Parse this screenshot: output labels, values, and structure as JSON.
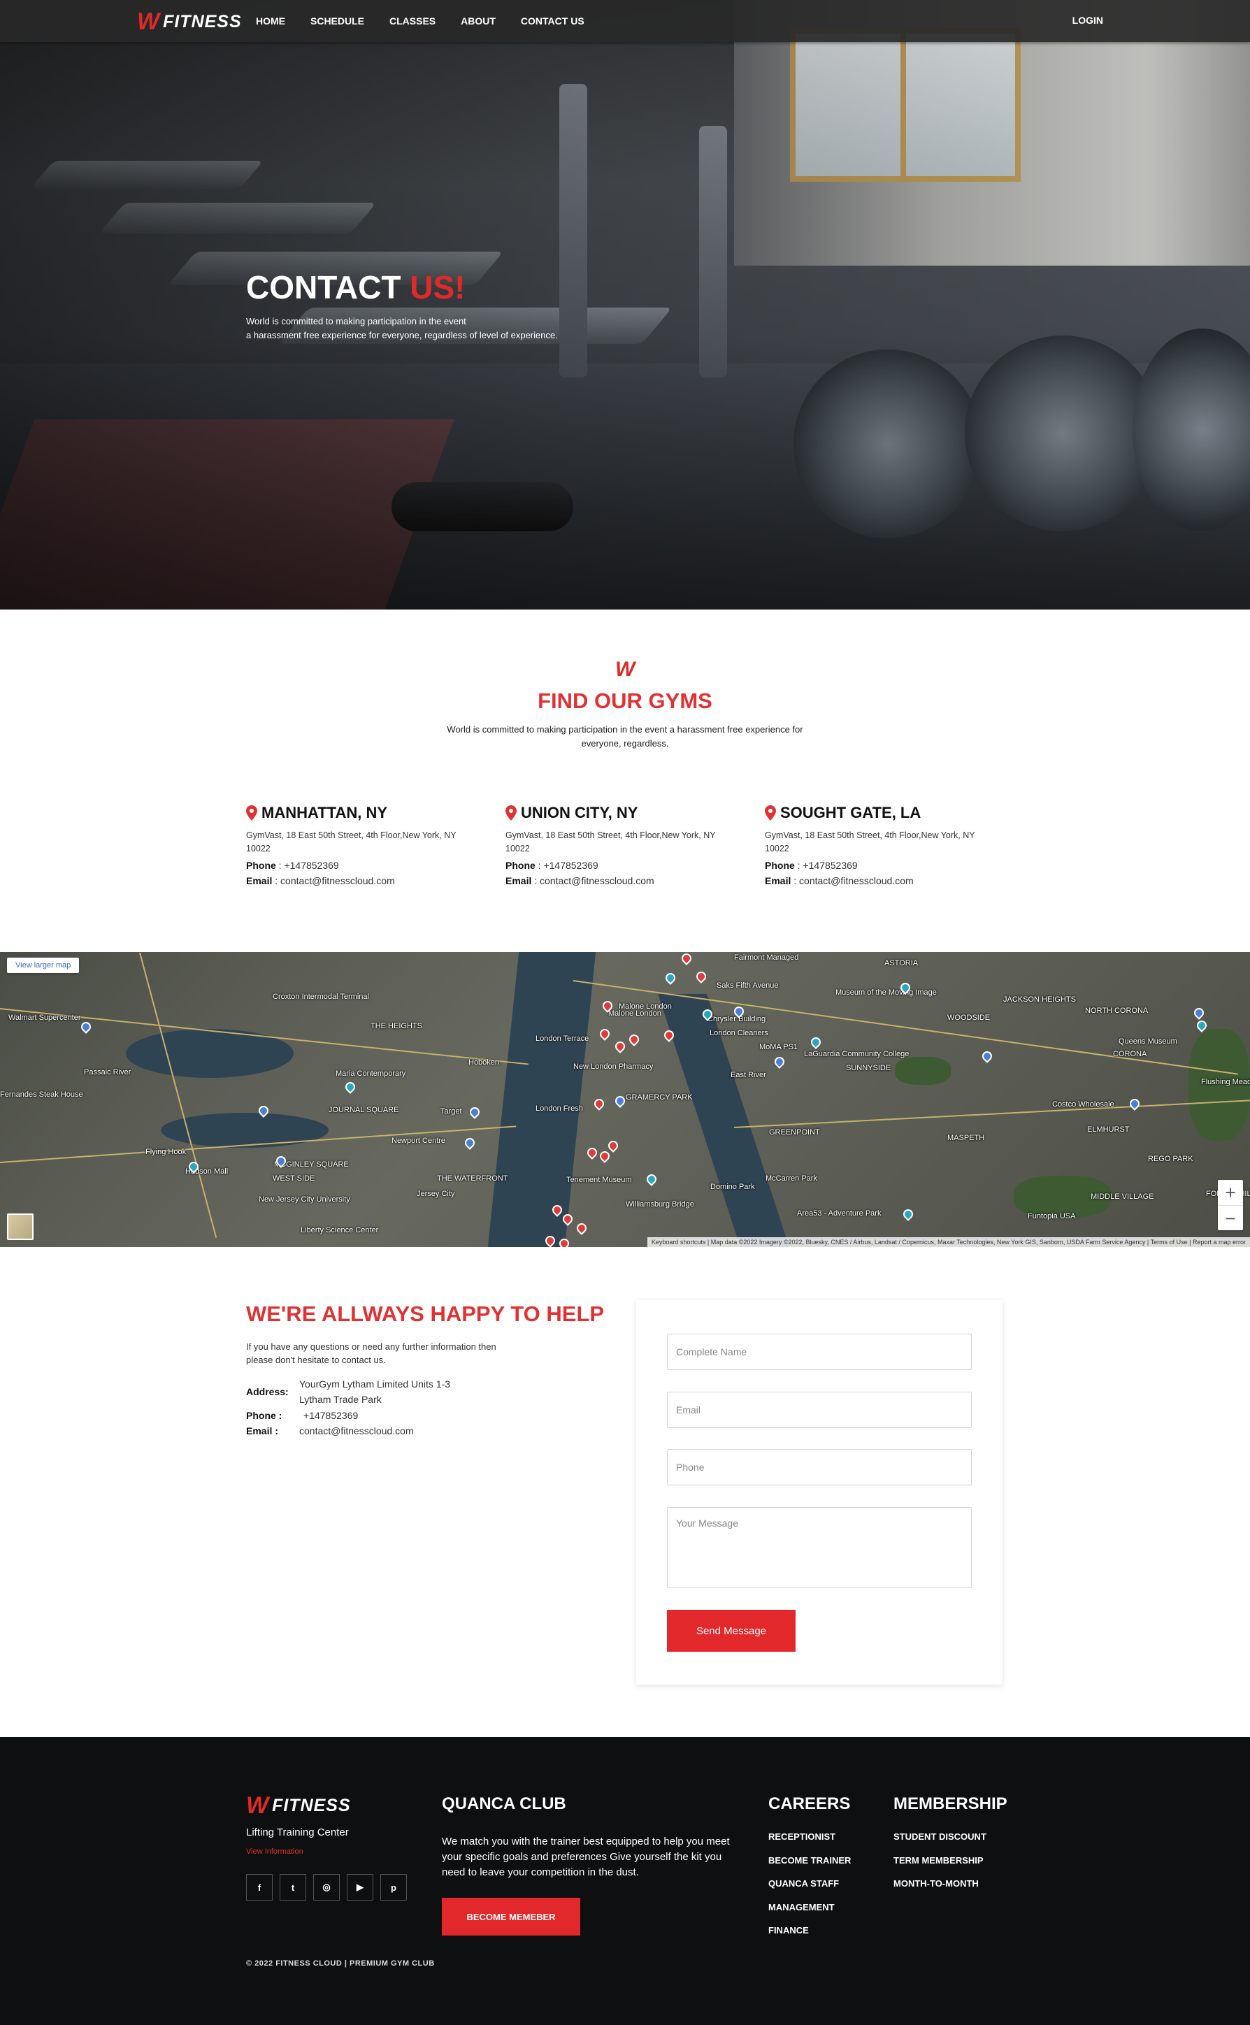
{
  "brand": {
    "name": "FITNESS",
    "accent": "#e03232"
  },
  "nav": {
    "links": [
      "HOME",
      "SCHEDULE",
      "CLASSES",
      "ABOUT",
      "CONTACT US"
    ],
    "login": "LOGIN"
  },
  "hero": {
    "title_white": "CONTACT ",
    "title_red": "US!",
    "subtitle_line1": "World is committed to making participation in the event",
    "subtitle_line2": "a harassment free experience for everyone, regardless of level of experience."
  },
  "find": {
    "title": "FIND OUR GYMS",
    "subtitle": "World is committed to making participation in the event a harassment free experience for everyone, regardless."
  },
  "gyms": [
    {
      "name": "MANHATTAN, NY",
      "address": "GymVast, 18 East 50th Street, 4th Floor,New York, NY 10022",
      "phone_label": "Phone",
      "phone": " : +147852369",
      "email_label": "Email",
      "email": " : contact@fitnesscloud.com"
    },
    {
      "name": "UNION CITY, NY",
      "address": "GymVast, 18 East 50th Street, 4th Floor,New York, NY 10022",
      "phone_label": "Phone",
      "phone": " : +147852369",
      "email_label": "Email",
      "email": " : contact@fitnesscloud.com"
    },
    {
      "name": "SOUGHT GATE, LA",
      "address": "GymVast, 18 East 50th Street, 4th Floor,New York, NY 10022",
      "phone_label": "Phone",
      "phone": " : +147852369",
      "email_label": "Email",
      "email": " : contact@fitnesscloud.com"
    }
  ],
  "map": {
    "view_larger": "View larger map",
    "zoom_in": "+",
    "zoom_out": "−",
    "attribution": "Keyboard shortcuts | Map data ©2022 Imagery ©2022, Bluesky, CNES / Airbus, Landsat / Copernicus, Maxar Technologies, New York GIS, Sanborn, USDA Farm Service Agency | Terms of Use | Report a map error",
    "labels": [
      "Walmart Supercenter",
      "THE HEIGHTS",
      "Croxton Intermodal Terminal",
      "Passaic River",
      "Fernandes Steak House",
      "Maria Contemporary",
      "JOURNAL SQUARE",
      "Target",
      "Newport Centre",
      "Hudson Mall",
      "WEST SIDE",
      "MCGINLEY SQUARE",
      "THE WATERFRONT",
      "Jersey City",
      "New Jersey City University",
      "Liberty Science Center",
      "London Terrace",
      "New London Pharmacy",
      "London Fresh",
      "Malone London",
      "Tenement Museum",
      "Williamsburg Bridge",
      "Domino Park",
      "McCarren Park",
      "GRAMERCY PARK",
      "GREENPOINT",
      "Chrysler Building",
      "MoMA PS1",
      "LaGuardia Community College",
      "SUNNYSIDE",
      "ASTORIA",
      "Museum of the Moving Image",
      "WOODSIDE",
      "JACKSON HEIGHTS",
      "NORTH CORONA",
      "Queens Museum",
      "CORONA",
      "ELMHURST",
      "Costco Wholesale",
      "MASPETH",
      "MIDDLE VILLAGE",
      "REGO PARK",
      "FOREST HILLS",
      "Funtopia USA",
      "Area53 - Adventure Park",
      "Flying Hook",
      "Fairmont Managed",
      "Saks Fifth Avenue",
      "Malone London",
      "London Cleaners",
      "Hoboken",
      "East River",
      "Flushing Meadows"
    ]
  },
  "help": {
    "title": "WE'RE ALLWAYS HAPPY TO HELP",
    "subtitle": "If you have any questions or need any further information then please don't hesitate to contact us.",
    "address_label": "Address:",
    "address_line1": "YourGym Lytham Limited Units 1-3",
    "address_line2": "Lytham Trade Park",
    "phone_label": "Phone :",
    "phone": "+147852369",
    "email_label": "Email :",
    "email": "contact@fitnesscloud.com"
  },
  "form": {
    "name_placeholder": "Complete Name",
    "email_placeholder": "Email",
    "phone_placeholder": "Phone",
    "message_placeholder": "Your Message",
    "send": "Send Message"
  },
  "footer": {
    "tagline": "Lifting Training Center",
    "view_info": "View Information",
    "socials": [
      "f",
      "t",
      "◎",
      "▶",
      "p"
    ],
    "club_title": "QUANCA CLUB",
    "club_text": "We match you with the trainer best equipped to help you meet your specific goals and preferences Give yourself the kit you need to leave your competition in the dust.",
    "become": "BECOME MEMEBER",
    "careers_title": "CAREERS",
    "careers": [
      "RECEPTIONIST",
      "BECOME TRAINER",
      "QUANCA STAFF",
      "MANAGEMENT",
      "FINANCE"
    ],
    "membership_title": "MEMBERSHIP",
    "membership": [
      "STUDENT DISCOUNT",
      "TERM MEMBERSHIP",
      "MONTH-TO-MONTH"
    ],
    "copyright": "© 2022 FITNESS CLOUD | PREMIUM GYM CLUB"
  }
}
